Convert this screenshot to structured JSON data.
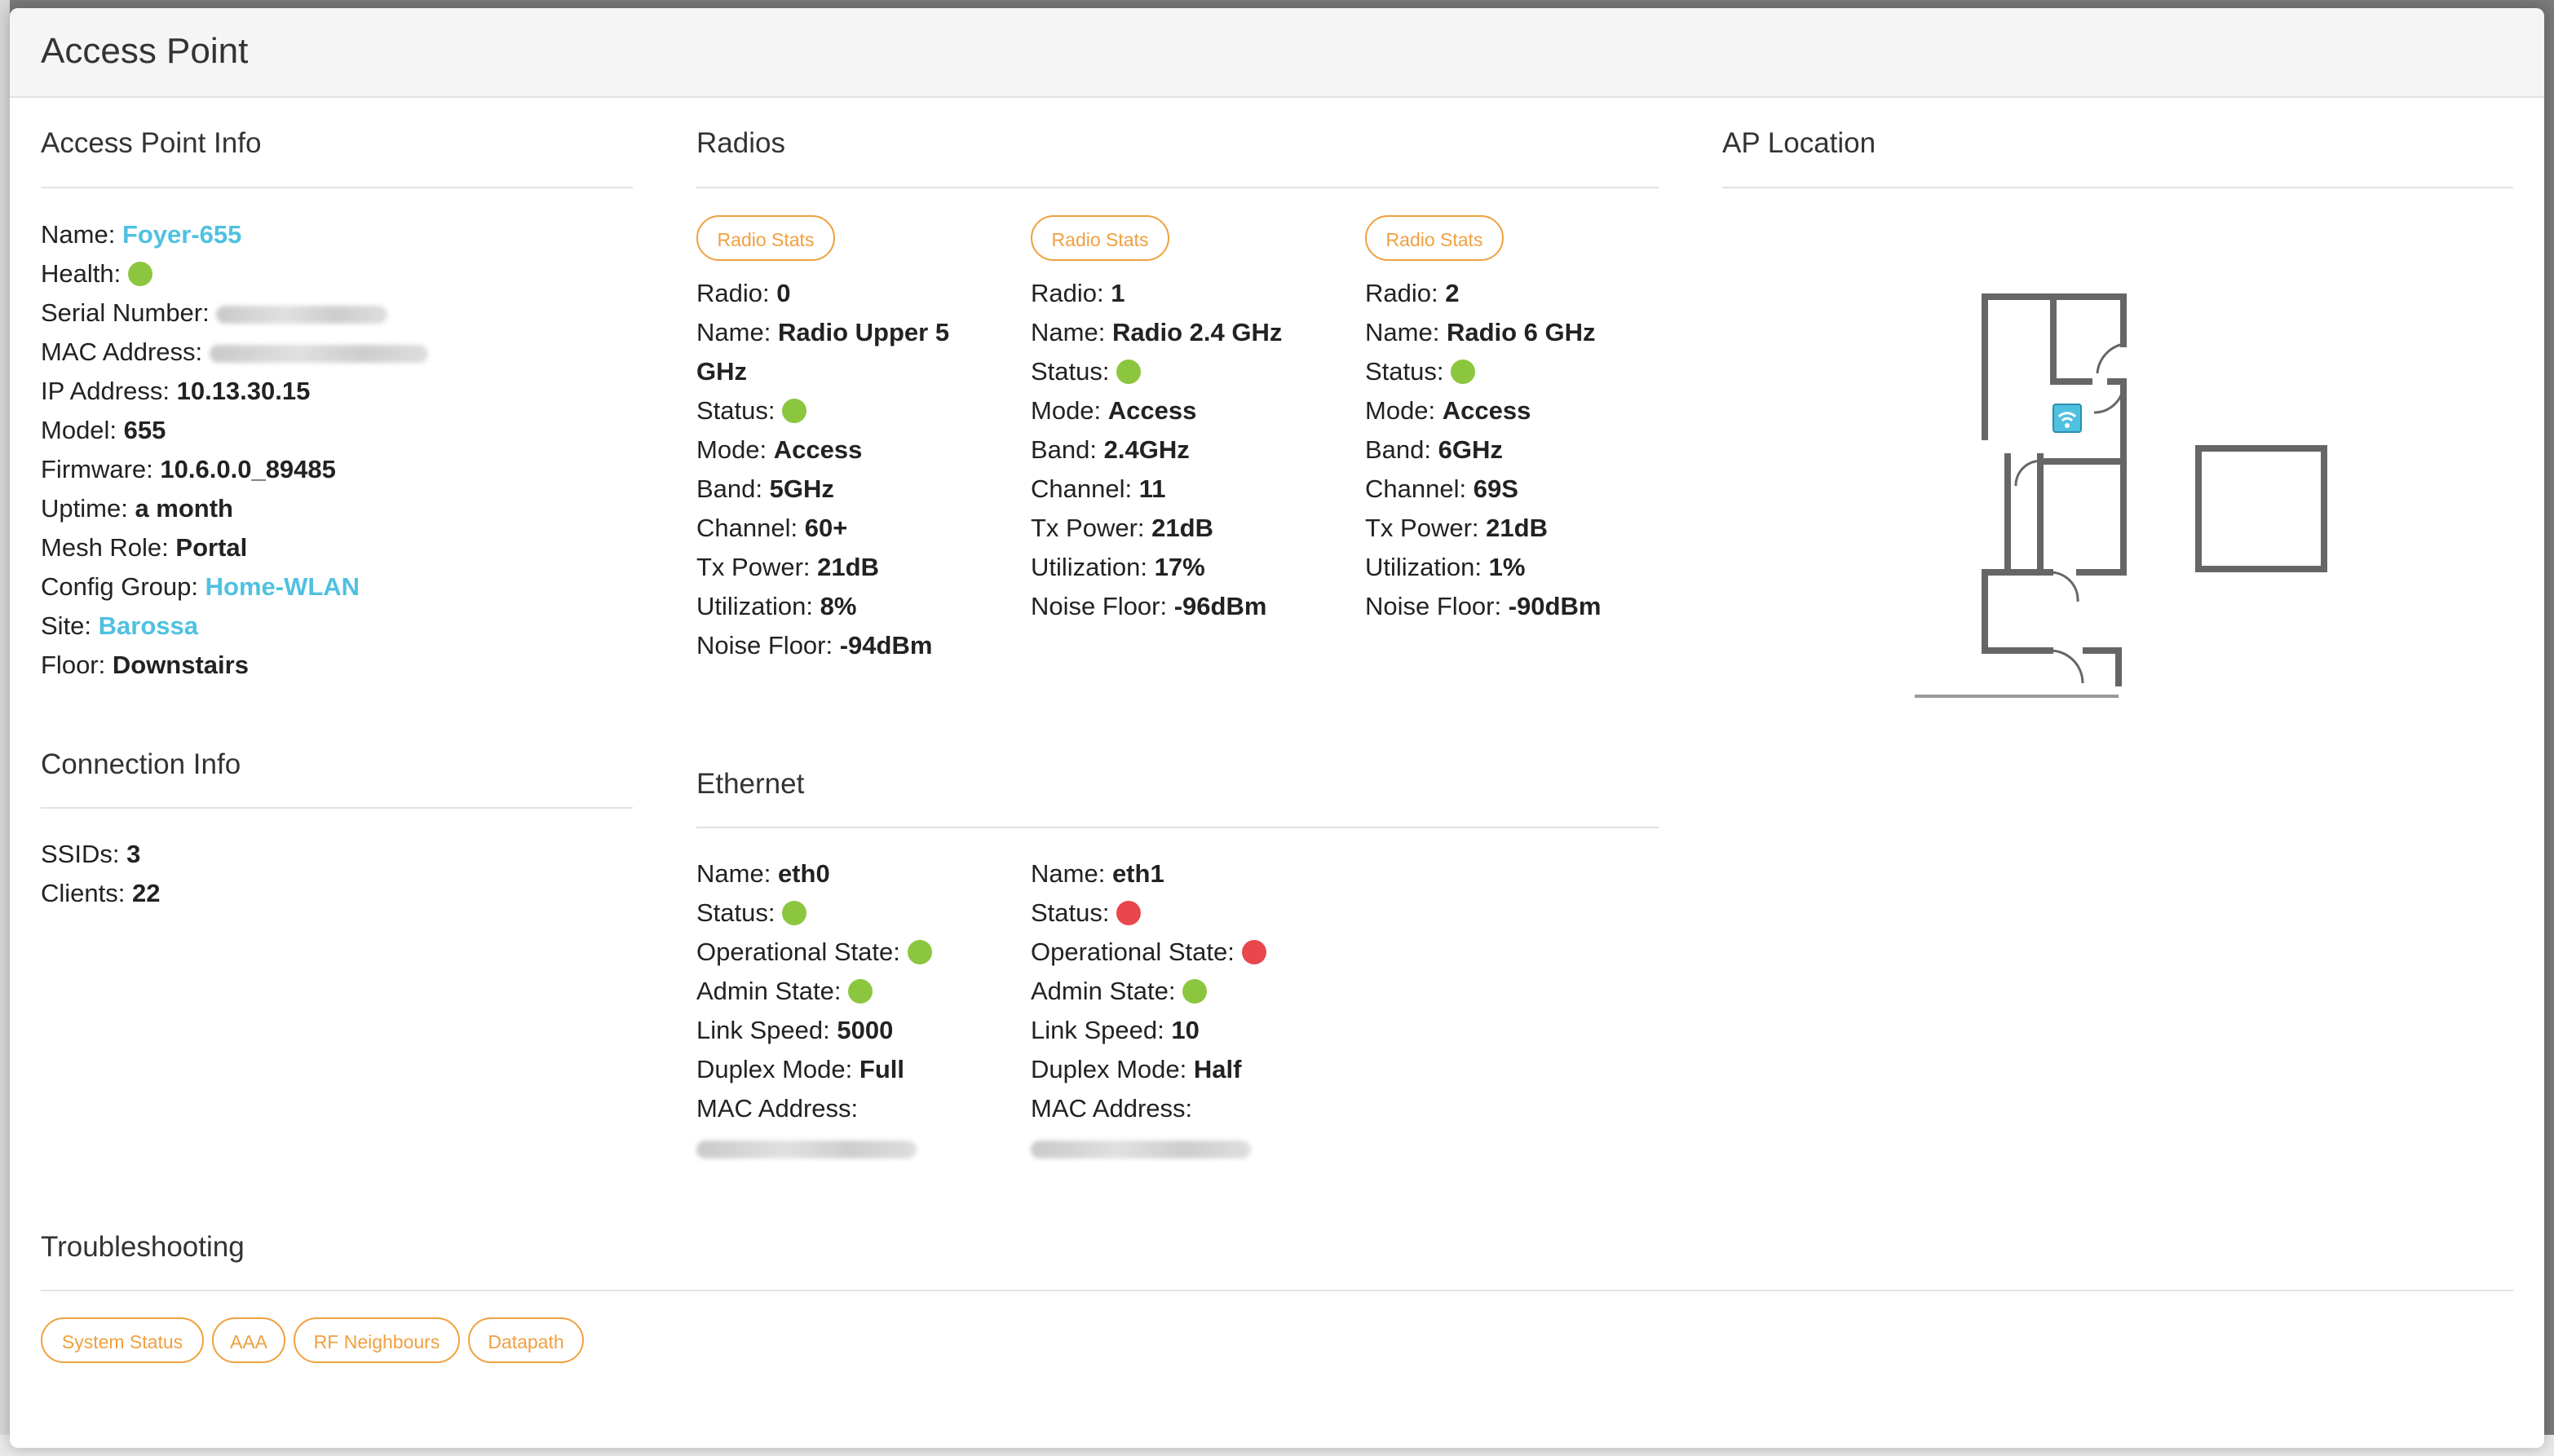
{
  "modal": {
    "title": "Access Point"
  },
  "ap_info": {
    "title": "Access Point Info",
    "name_label": "Name:",
    "name_value": "Foyer-655",
    "health_label": "Health:",
    "serial_label": "Serial Number:",
    "mac_label": "MAC Address:",
    "ip_label": "IP Address:",
    "ip_value": "10.13.30.15",
    "model_label": "Model:",
    "model_value": "655",
    "firmware_label": "Firmware:",
    "firmware_value": "10.6.0.0_89485",
    "uptime_label": "Uptime:",
    "uptime_value": "a month",
    "mesh_label": "Mesh Role:",
    "mesh_value": "Portal",
    "config_label": "Config Group:",
    "config_value": "Home-WLAN",
    "site_label": "Site:",
    "site_value": "Barossa",
    "floor_label": "Floor:",
    "floor_value": "Downstairs"
  },
  "connection": {
    "title": "Connection Info",
    "ssids_label": "SSIDs:",
    "ssids_value": "3",
    "clients_label": "Clients:",
    "clients_value": "22"
  },
  "radios": {
    "title": "Radios",
    "stats_button": "Radio Stats",
    "labels": {
      "radio": "Radio:",
      "name": "Name:",
      "status": "Status:",
      "mode": "Mode:",
      "band": "Band:",
      "channel": "Channel:",
      "tx": "Tx Power:",
      "util": "Utilization:",
      "noise": "Noise Floor:"
    },
    "items": [
      {
        "radio": "0",
        "name": "Radio Upper 5 GHz",
        "mode": "Access",
        "band": "5GHz",
        "channel": "60+",
        "tx": "21dB",
        "util": "8%",
        "noise": "-94dBm"
      },
      {
        "radio": "1",
        "name": "Radio 2.4 GHz",
        "mode": "Access",
        "band": "2.4GHz",
        "channel": "11",
        "tx": "21dB",
        "util": "17%",
        "noise": "-96dBm"
      },
      {
        "radio": "2",
        "name": "Radio 6 GHz",
        "mode": "Access",
        "band": "6GHz",
        "channel": "69S",
        "tx": "21dB",
        "util": "1%",
        "noise": "-90dBm"
      }
    ]
  },
  "ethernet": {
    "title": "Ethernet",
    "labels": {
      "name": "Name:",
      "status": "Status:",
      "op": "Operational State:",
      "admin": "Admin State:",
      "speed": "Link Speed:",
      "duplex": "Duplex Mode:",
      "mac": "MAC Address:"
    },
    "items": [
      {
        "name": "eth0",
        "status_color": "#8cc63f",
        "op_color": "#8cc63f",
        "admin_color": "#8cc63f",
        "speed": "5000",
        "duplex": "Full"
      },
      {
        "name": "eth1",
        "status_color": "#e8474d",
        "op_color": "#e8474d",
        "admin_color": "#8cc63f",
        "speed": "10",
        "duplex": "Half"
      }
    ]
  },
  "location": {
    "title": "AP Location",
    "icon": "wifi-icon"
  },
  "troubleshooting": {
    "title": "Troubleshooting",
    "buttons": [
      "System Status",
      "AAA",
      "RF Neighbours",
      "Datapath"
    ]
  },
  "colors": {
    "accent": "#f0a040",
    "link": "#4fc1e0",
    "status_ok": "#8cc63f",
    "status_bad": "#e8474d"
  }
}
